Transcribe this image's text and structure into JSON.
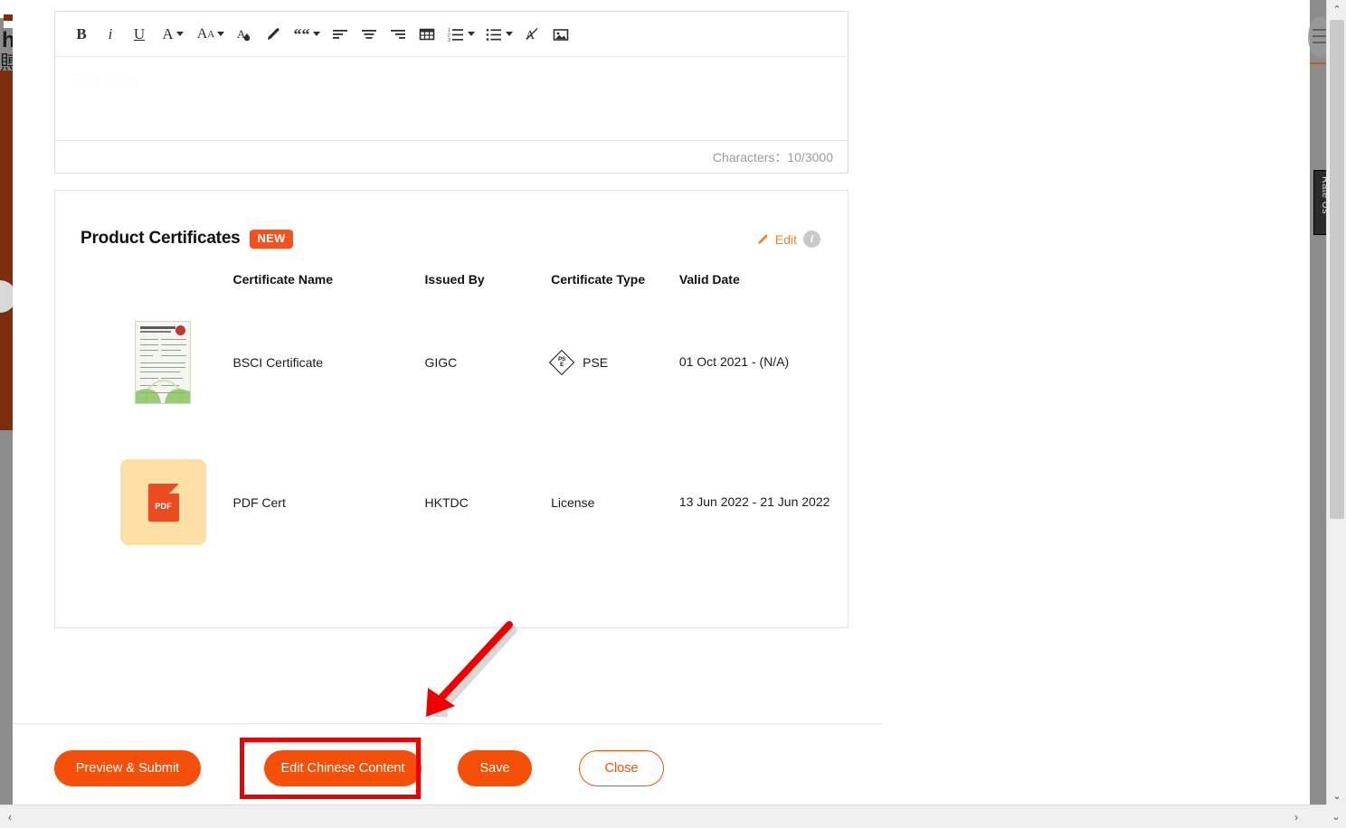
{
  "editor": {
    "toolbar": [
      {
        "name": "bold-icon",
        "label": "B"
      },
      {
        "name": "italic-icon",
        "label": "i"
      },
      {
        "name": "underline-icon",
        "label": "U"
      },
      {
        "name": "font-color-icon",
        "label": "A"
      },
      {
        "name": "font-size-icon",
        "label": "AA"
      },
      {
        "name": "text-highlight-color-icon",
        "label": "A"
      },
      {
        "name": "clear-formatting-icon",
        "label": "eraser"
      },
      {
        "name": "blockquote-icon",
        "label": "““"
      },
      {
        "name": "align-left-icon",
        "label": "align-left"
      },
      {
        "name": "align-center-icon",
        "label": "align-center"
      },
      {
        "name": "align-right-icon",
        "label": "align-right"
      },
      {
        "name": "insert-table-icon",
        "label": "table"
      },
      {
        "name": "ordered-list-icon",
        "label": "numbered-list"
      },
      {
        "name": "unordered-list-icon",
        "label": "bullet-list"
      },
      {
        "name": "remove-format-icon",
        "label": "A-strike"
      },
      {
        "name": "insert-image-icon",
        "label": "image"
      }
    ],
    "content_text": "Polo Shirt",
    "character_counter": "Characters：10/3000"
  },
  "certificates_card": {
    "title": "Product Certificates",
    "badge": "NEW",
    "edit_label": "Edit",
    "info_glyph": "i",
    "columns": [
      "",
      "Certificate Name",
      "Issued By",
      "Certificate Type",
      "Valid Date"
    ],
    "rows": [
      {
        "thumbnail": "certificate-image-thumbnail",
        "certificate_name": "BSCI Certificate",
        "issued_by": "GIGC",
        "certificate_type": "PSE",
        "certificate_type_icon": "pse-diamond-icon",
        "pse_top": "PS",
        "pse_bottom": "E",
        "valid_date": "01 Oct 2021 - (N/A)"
      },
      {
        "thumbnail": "pdf-file-icon",
        "thumbnail_label": "PDF",
        "certificate_name": "PDF Cert",
        "issued_by": "HKTDC",
        "certificate_type": "License",
        "certificate_type_icon": "",
        "valid_date": "13 Jun 2022 - 21 Jun 2022"
      }
    ]
  },
  "footer": {
    "preview_submit": "Preview & Submit",
    "edit_chinese_content": "Edit Chinese Content",
    "save": "Save",
    "close": "Close"
  },
  "background": {
    "left_text": "h",
    "left_cjk": "賻",
    "rate_tab": "Rate Us"
  },
  "scrollbars": {
    "up_arrow": "⌃",
    "down_arrow": "⌄",
    "left_arrow": "‹",
    "right_arrow": "›",
    "corner_arrow": "⌄"
  },
  "colors": {
    "accent_orange": "#f4500a",
    "badge_orange": "#f4511e",
    "edit_orange": "#f5842a",
    "annotation_red": "#ef0000",
    "pdf_tile": "#fbdfa4",
    "pdf_red": "#ec4a20"
  }
}
